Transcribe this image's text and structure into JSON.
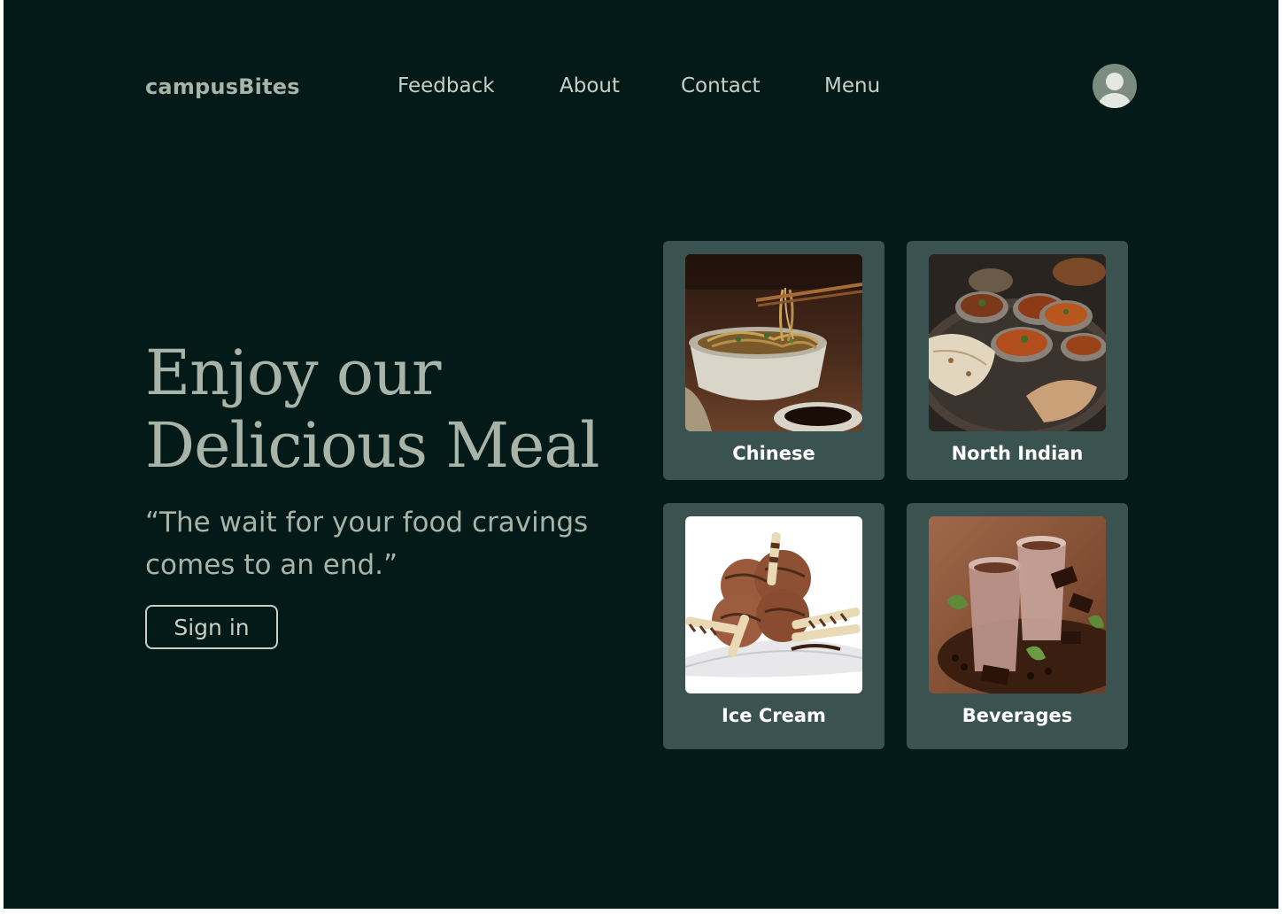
{
  "brand": "campusBites",
  "nav": [
    "Feedback",
    "About",
    "Contact",
    "Menu"
  ],
  "hero": {
    "title_line1": "Enjoy our",
    "title_line2": "Delicious Meal",
    "tagline": "“The wait for your food cravings comes to an end.”",
    "signin_label": "Sign in"
  },
  "categories": [
    {
      "label": "Chinese",
      "icon": "noodle-bowl-photo"
    },
    {
      "label": "North Indian",
      "icon": "curry-thali-photo"
    },
    {
      "label": "Ice Cream",
      "icon": "chocolate-ice-cream-photo"
    },
    {
      "label": "Beverages",
      "icon": "chocolate-milkshake-photo"
    }
  ],
  "colors": {
    "background": "#031a18",
    "card": "#3b5350",
    "text_muted": "#a9b4a8",
    "avatar": "#7d8c80"
  }
}
